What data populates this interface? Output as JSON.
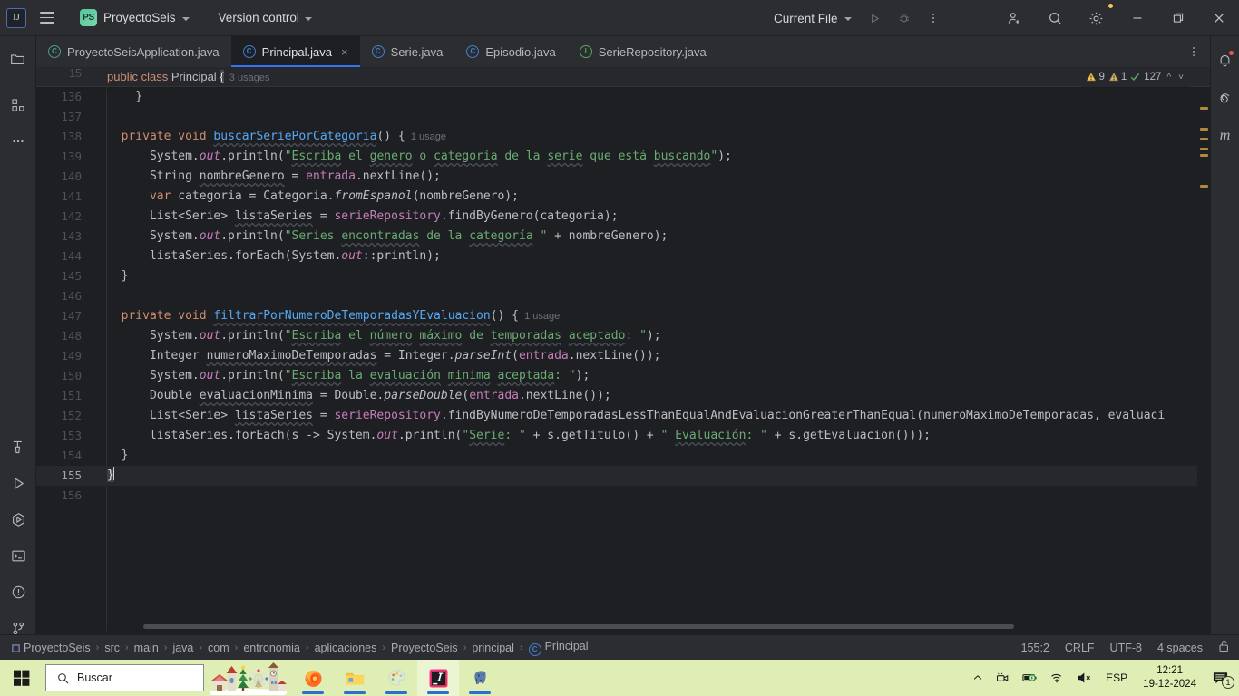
{
  "titlebar": {
    "logo_icon": "intellij-idea-logo",
    "menu_icon": "hamburger-menu-icon",
    "project_badge": "PS",
    "project_name": "ProyectoSeis",
    "version_control": "Version control",
    "run_config": "Current File",
    "run_icon": "run-play-icon",
    "debug_icon": "debug-bug-icon",
    "more_icon": "more-vertical-icon",
    "share_icon": "add-user-icon",
    "search_icon": "search-icon",
    "settings_icon": "gear-icon",
    "minimize_icon": "minimize-icon",
    "maximize_icon": "maximize-restore-icon",
    "close_icon": "close-icon"
  },
  "left_rail": {
    "top": [
      {
        "name": "project-tool-window",
        "icon": "folder-icon"
      },
      {
        "name": "commit-tool-window",
        "icon": "structure-grid-icon"
      },
      {
        "name": "more-tool-windows",
        "icon": "ellipsis-icon"
      }
    ],
    "bottom": [
      {
        "name": "build-tool-window",
        "icon": "hammer-icon"
      },
      {
        "name": "run-tool-window",
        "icon": "play-triangle-icon"
      },
      {
        "name": "debug-tool-window",
        "icon": "debug-hex-icon"
      },
      {
        "name": "terminal-tool-window",
        "icon": "terminal-icon"
      },
      {
        "name": "problems-tool-window",
        "icon": "warning-circle-icon"
      },
      {
        "name": "version-control-tool-window",
        "icon": "git-branch-icon"
      }
    ]
  },
  "right_rail": [
    {
      "name": "notifications",
      "icon": "bell-icon",
      "badge": true
    },
    {
      "name": "ai-assistant",
      "icon": "spiral-icon",
      "badge": false
    },
    {
      "name": "maven",
      "icon": "maven-m-icon",
      "badge": false,
      "label": "m"
    }
  ],
  "tabs": [
    {
      "label": "ProyectoSeisApplication.java",
      "icon_letter": "C",
      "icon_color": "#4a9c8c",
      "active": false,
      "closable": false
    },
    {
      "label": "Principal.java",
      "icon_letter": "C",
      "icon_color": "#3f7fd6",
      "active": true,
      "closable": true,
      "close_glyph": "×"
    },
    {
      "label": "Serie.java",
      "icon_letter": "C",
      "icon_color": "#3f7fd6",
      "active": false,
      "closable": false
    },
    {
      "label": "Episodio.java",
      "icon_letter": "C",
      "icon_color": "#3f7fd6",
      "active": false,
      "closable": false
    },
    {
      "label": "SerieRepository.java",
      "icon_letter": "I",
      "icon_color": "#58a65c",
      "active": false,
      "closable": false
    }
  ],
  "tabbar_more_icon": "tab-options-icon",
  "sticky_header": {
    "line_number": "15",
    "usage_label": "3 usages"
  },
  "inspections": {
    "warnings_icon": "warning-triangle-icon",
    "warnings_count": "9",
    "weak_warnings_icon": "weak-warning-triangle-icon",
    "weak_warnings_count": "1",
    "ok_icon": "inspection-check-icon",
    "ok_count": "127",
    "prev_icon": "chevron-up-icon",
    "next_icon": "chevron-down-icon"
  },
  "editor": {
    "line_numbers": [
      "136",
      "137",
      "138",
      "139",
      "140",
      "141",
      "142",
      "143",
      "144",
      "145",
      "146",
      "147",
      "148",
      "149",
      "150",
      "151",
      "152",
      "153",
      "154",
      "155",
      "156"
    ],
    "current_line": "155",
    "lines": [
      {
        "n": "136",
        "text": "        }"
      },
      {
        "n": "137",
        "text": ""
      },
      {
        "n": "138",
        "text": "    private void buscarSeriePorCategoria() {   1 usage"
      },
      {
        "n": "139",
        "text": "        System.out.println(\"Escriba el genero o categoria de la serie que está buscando\");"
      },
      {
        "n": "140",
        "text": "        String nombreGenero = entrada.nextLine();"
      },
      {
        "n": "141",
        "text": "        var categoria = Categoria.fromEspanol(nombreGenero);"
      },
      {
        "n": "142",
        "text": "        List<Serie> listaSeries = serieRepository.findByGenero(categoria);"
      },
      {
        "n": "143",
        "text": "        System.out.println(\"Series encontradas de la categoría \" + nombreGenero);"
      },
      {
        "n": "144",
        "text": "        listaSeries.forEach(System.out::println);"
      },
      {
        "n": "145",
        "text": "    }"
      },
      {
        "n": "146",
        "text": ""
      },
      {
        "n": "147",
        "text": "    private void filtrarPorNumeroDeTemporadasYEvaluacion() {   1 usage"
      },
      {
        "n": "148",
        "text": "        System.out.println(\"Escriba el número máximo de temporadas aceptado: \");"
      },
      {
        "n": "149",
        "text": "        Integer numeroMaximoDeTemporadas = Integer.parseInt(entrada.nextLine());"
      },
      {
        "n": "150",
        "text": "        System.out.println(\"Escriba la evaluación minima aceptada: \");"
      },
      {
        "n": "151",
        "text": "        Double evaluacionMinima = Double.parseDouble(entrada.nextLine());"
      },
      {
        "n": "152",
        "text": "        List<Serie> listaSeries = serieRepository.findByNumeroDeTemporadasLessThanEqualAndEvaluacionGreaterThanEqual(numeroMaximoDeTemporadas, evaluaci"
      },
      {
        "n": "153",
        "text": "        listaSeries.forEach(s -> System.out.println(\"Serie: \" + s.getTitulo() + \" Evaluación: \" + s.getEvaluacion()));"
      },
      {
        "n": "154",
        "text": "    }"
      },
      {
        "n": "155",
        "text": "}"
      },
      {
        "n": "156",
        "text": ""
      }
    ],
    "sticky_text": "public class Principal {",
    "usage_hints": [
      "3 usages",
      "1 usage",
      "1 usage"
    ]
  },
  "statusbar": {
    "breadcrumb_root_icon": "module-icon",
    "breadcrumbs": [
      "ProyectoSeis",
      "src",
      "main",
      "java",
      "com",
      "entronomia",
      "aplicaciones",
      "ProyectoSeis",
      "principal",
      "Principal"
    ],
    "breadcrumb_last_icon": "class-icon",
    "separator": "›",
    "caret_position": "155:2",
    "line_separator": "CRLF",
    "encoding": "UTF-8",
    "indent": "4 spaces",
    "lock_icon": "unlocked-padlock-icon"
  },
  "taskbar": {
    "start_icon": "windows-start-icon",
    "search_icon": "search-icon",
    "search_placeholder": "Buscar",
    "widget_name": "christmas-village-widget",
    "apps": [
      {
        "name": "firefox",
        "icon": "firefox-icon",
        "running": true,
        "active": false
      },
      {
        "name": "file-explorer",
        "icon": "folder-explorer-icon",
        "running": true,
        "active": false
      },
      {
        "name": "paint",
        "icon": "paint-palette-icon",
        "running": true,
        "active": false
      },
      {
        "name": "intellij-idea",
        "icon": "intellij-idea-icon",
        "running": true,
        "active": true
      },
      {
        "name": "pgadmin",
        "icon": "postgresql-elephant-icon",
        "running": true,
        "active": false
      }
    ],
    "tray": {
      "show_hidden_icon": "chevron-up-icon",
      "camera_icon": "webcam-icon",
      "battery_icon": "battery-icon",
      "wifi_icon": "wifi-icon",
      "volume_icon": "volume-muted-icon",
      "language": "ESP",
      "time": "12:21",
      "date": "19-12-2024",
      "notification_icon": "notification-center-icon",
      "notification_count": "1"
    }
  },
  "colors": {
    "accent": "#3573f0",
    "editor_bg": "#1e1f22",
    "chrome_bg": "#2b2d30",
    "taskbar_bg": "#dfeeb4",
    "string": "#6aab73",
    "keyword": "#cf8e6d",
    "method": "#56a8f5",
    "field": "#c77dbb"
  }
}
